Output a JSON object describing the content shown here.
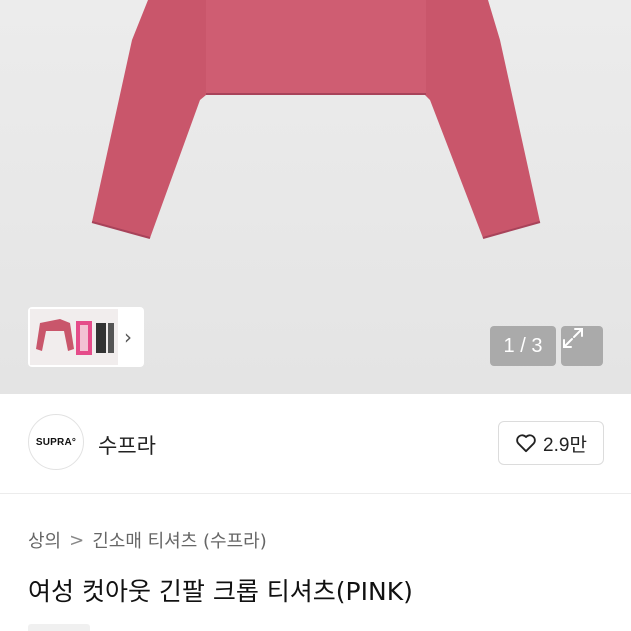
{
  "gallery": {
    "counter": "1 / 3",
    "expand_icon": "expand-icon",
    "next_icon": "chevron-right-icon"
  },
  "seller": {
    "logo_text": "SUPRA°",
    "name": "수프라",
    "like_icon": "heart-outline-icon",
    "like_count": "2.9만"
  },
  "breadcrumb": {
    "items": [
      "상의",
      "긴소매 티셔츠 (수프라)"
    ],
    "separator": ">"
  },
  "product": {
    "title": "여성 컷아웃 긴팔 크롭 티셔츠(PINK)",
    "color_hex": "#c9566b"
  }
}
